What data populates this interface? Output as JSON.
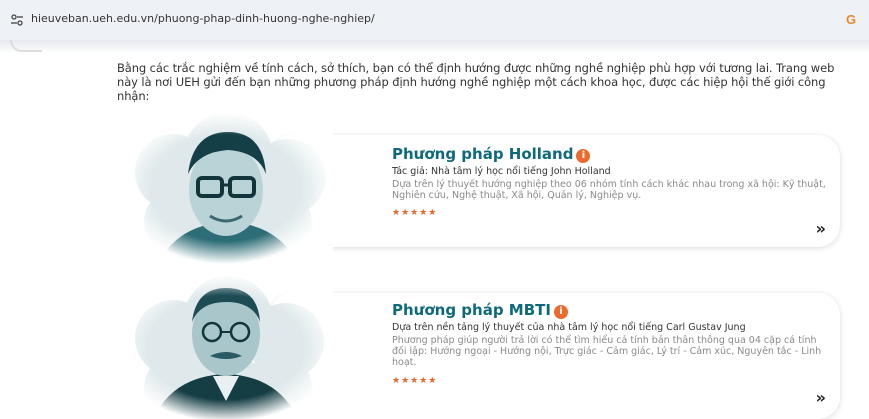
{
  "browser": {
    "url": "hieuveban.ueh.edu.vn/phuong-phap-dinh-huong-nghe-nghiep/",
    "google_icon_glyph": "G"
  },
  "intro": "Bằng các trắc nghiệm về tính cách, sở thích, bạn có thể định hướng được những nghề nghiệp phù hợp với tương lai. Trang web này là nơi UEH gửi đến bạn những phương pháp định hướng nghề nghiệp một cách khoa học, được các hiệp hội thế giới công nhận:",
  "methods": [
    {
      "title": "Phương pháp Holland",
      "info_glyph": "i",
      "subtitle": "Tác giả: Nhà tâm lý học nổi tiếng John Holland",
      "description": "Dựa trên lý thuyết hướng nghiệp theo 06 nhóm tính cách khác nhau trong xã hội: Kỹ thuật, Nghiên cứu, Nghệ thuật, Xã hội, Quản lý, Nghiệp vụ.",
      "stars": "★★★★★",
      "more_glyph": "»"
    },
    {
      "title": "Phương pháp MBTI",
      "info_glyph": "i",
      "subtitle": "Dựa trên nền tảng lý thuyết của nhà tâm lý học nổi tiếng Carl Gustav Jung",
      "description": "Phương pháp giúp người trả lời có thể tìm hiểu cá tính bản thân thông qua 04 cặp cá tính đối lập: Hướng ngoại - Hướng nội, Trực giác - Cảm giác, Lý trí - Cảm xúc, Nguyên tắc - Linh hoạt.",
      "stars": "★★★★★",
      "more_glyph": "»"
    }
  ],
  "colors": {
    "title": "#0e6a78",
    "accent": "#ea6b2d",
    "portrait_tint": "#1c5a66"
  }
}
